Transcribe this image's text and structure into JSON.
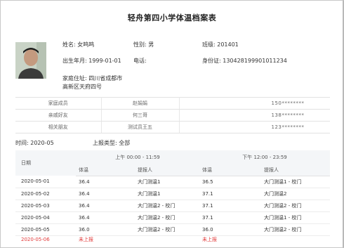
{
  "title": "轻舟第四小学体温档案表",
  "student": {
    "name": "姓名: 女鸣鸣",
    "gender": "性别: 男",
    "class": "班级: 201401",
    "birth": "出生年月: 1999-01-01",
    "phone": "电话:",
    "id_card": "身份证: 130428199901011234",
    "address_line1": "家庭住址: 四川省成都市",
    "address_line2": "高新区天府四号"
  },
  "contacts": [
    {
      "relation": "家庭成员",
      "name": "赵娟娟",
      "phone": "150********"
    },
    {
      "relation": "亲戚好友",
      "name": "何三哥",
      "phone": "138********"
    },
    {
      "relation": "相关朋友",
      "name": "测试员王五",
      "phone": "123********"
    }
  ],
  "filters": {
    "time": "时间: 2020-05",
    "report_type": "上报类型: 全部"
  },
  "table": {
    "date_header": "日期",
    "morning_header": "上午 00:00 - 11:59",
    "afternoon_header": "下午 12:00 - 23:59",
    "temp_header": "体温",
    "reporter_header": "提报人",
    "rows": [
      {
        "date": "2020-05-01",
        "am_temp": "36.4",
        "am_reporter": "大门测温1",
        "pm_temp": "36.5",
        "pm_reporter": "大门测温1 - 校门"
      },
      {
        "date": "2020-05-02",
        "am_temp": "36.4",
        "am_reporter": "大门测温1",
        "pm_temp": "37.1",
        "pm_reporter": "大门测温2"
      },
      {
        "date": "2020-05-03",
        "am_temp": "36.4",
        "am_reporter": "大门测温2 - 校门",
        "pm_temp": "37.1",
        "pm_reporter": "大门测温2 - 校门"
      },
      {
        "date": "2020-05-04",
        "am_temp": "36.4",
        "am_reporter": "大门测温2 - 校门",
        "pm_temp": "37.1",
        "pm_reporter": "大门测温1 - 校门"
      },
      {
        "date": "2020-05-05",
        "am_temp": "36.0",
        "am_reporter": "大门测温2 - 校门",
        "pm_temp": "36.0",
        "pm_reporter": "大门测温2 - 校门"
      },
      {
        "date": "2020-05-06",
        "am_temp": "未上报",
        "am_reporter": "",
        "pm_temp": "未上报",
        "pm_reporter": ""
      }
    ]
  },
  "colors": {
    "absent": "#e23a3a",
    "header_bg": "#f4f6f8"
  }
}
